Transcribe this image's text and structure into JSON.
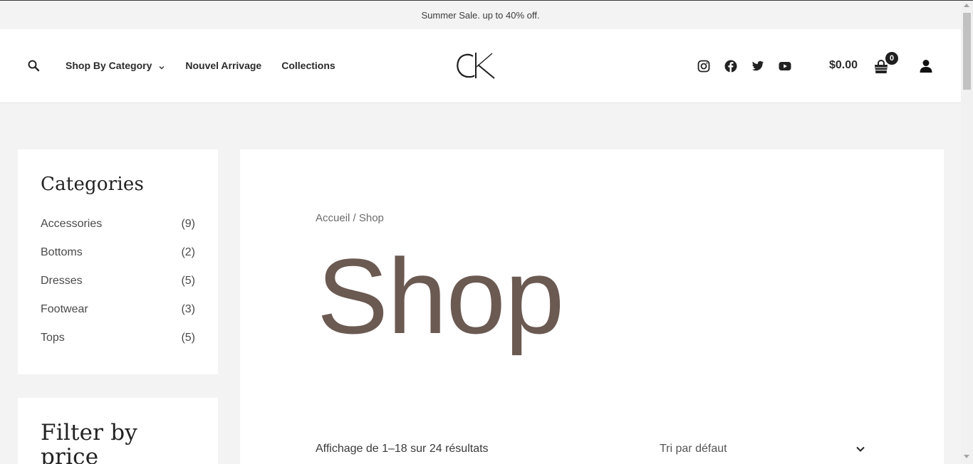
{
  "announcement": "Summer Sale. up to 40% off.",
  "nav": {
    "shop_by_category": "Shop By Category",
    "nouvel_arrivage": "Nouvel Arrivage",
    "collections": "Collections"
  },
  "logo_text": "CK",
  "icons": {
    "search": "search-icon",
    "social": [
      "instagram-icon",
      "facebook-icon",
      "twitter-icon",
      "youtube-icon"
    ],
    "cart": "shopping-bag-icon",
    "account": "user-icon"
  },
  "cart": {
    "total": "$0.00",
    "count": "0"
  },
  "sidebar": {
    "categories_title": "Categories",
    "categories": [
      {
        "name": "Accessories",
        "count": "(9)"
      },
      {
        "name": "Bottoms",
        "count": "(2)"
      },
      {
        "name": "Dresses",
        "count": "(5)"
      },
      {
        "name": "Footwear",
        "count": "(3)"
      },
      {
        "name": "Tops",
        "count": "(5)"
      }
    ],
    "filter_title": "Filter by price"
  },
  "main": {
    "breadcrumb": "Accueil / Shop",
    "title": "Shop",
    "result_count": "Affichage de 1–18 sur 24 résultats",
    "sort_selected": "Tri par défaut"
  },
  "colors": {
    "title_brown": "#6b5a52",
    "background": "#f3f3f4"
  }
}
